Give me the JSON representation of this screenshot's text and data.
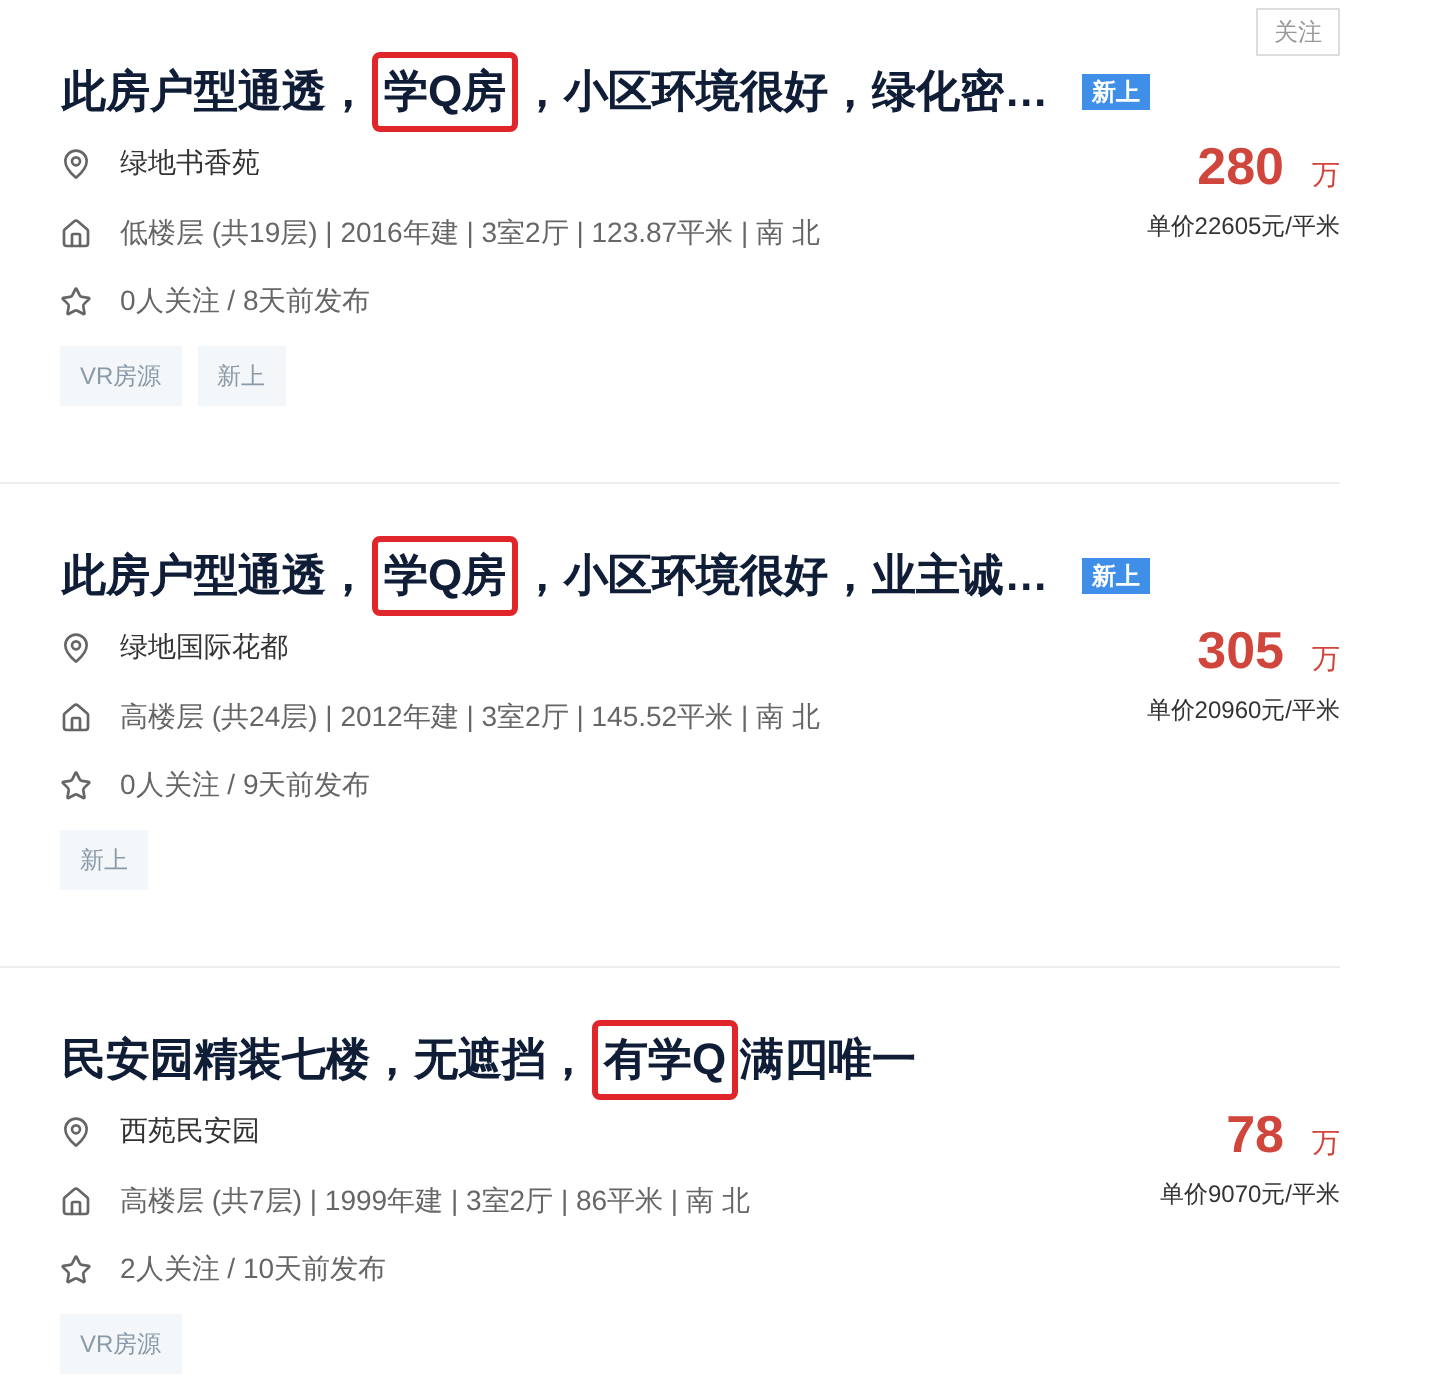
{
  "listings": [
    {
      "follow_button": "关注",
      "title": [
        {
          "text": "此房户型通透，",
          "highlighted": false
        },
        {
          "text": "学Q房",
          "highlighted": true
        },
        {
          "text": "，小区环境很好，绿化密…",
          "highlighted": false
        }
      ],
      "badge": "新上",
      "community": "绿地书香苑",
      "features": "低楼层 (共19层) | 2016年建 | 3室2厅 | 123.87平米 | 南 北",
      "stats": "0人关注 / 8天前发布",
      "tags": [
        "VR房源",
        "新上"
      ],
      "price": "280",
      "price_unit": "万",
      "unit_price": "单价22605元/平米"
    },
    {
      "title": [
        {
          "text": "此房户型通透，",
          "highlighted": false
        },
        {
          "text": "学Q房",
          "highlighted": true
        },
        {
          "text": "，小区环境很好，业主诚…",
          "highlighted": false
        }
      ],
      "badge": "新上",
      "community": "绿地国际花都",
      "features": "高楼层 (共24层) | 2012年建 | 3室2厅 | 145.52平米 | 南 北",
      "stats": "0人关注 / 9天前发布",
      "tags": [
        "新上"
      ],
      "price": "305",
      "price_unit": "万",
      "unit_price": "单价20960元/平米"
    },
    {
      "title": [
        {
          "text": "民安园精装七楼，无遮挡，",
          "highlighted": false
        },
        {
          "text": "有学Q",
          "highlighted": true
        },
        {
          "text": "满四唯一",
          "highlighted": false
        }
      ],
      "community": "西苑民安园",
      "features": "高楼层 (共7层) | 1999年建 | 3室2厅 | 86平米 | 南 北",
      "stats": "2人关注 / 10天前发布",
      "tags": [
        "VR房源"
      ],
      "price": "78",
      "price_unit": "万",
      "unit_price": "单价9070元/平米"
    }
  ]
}
